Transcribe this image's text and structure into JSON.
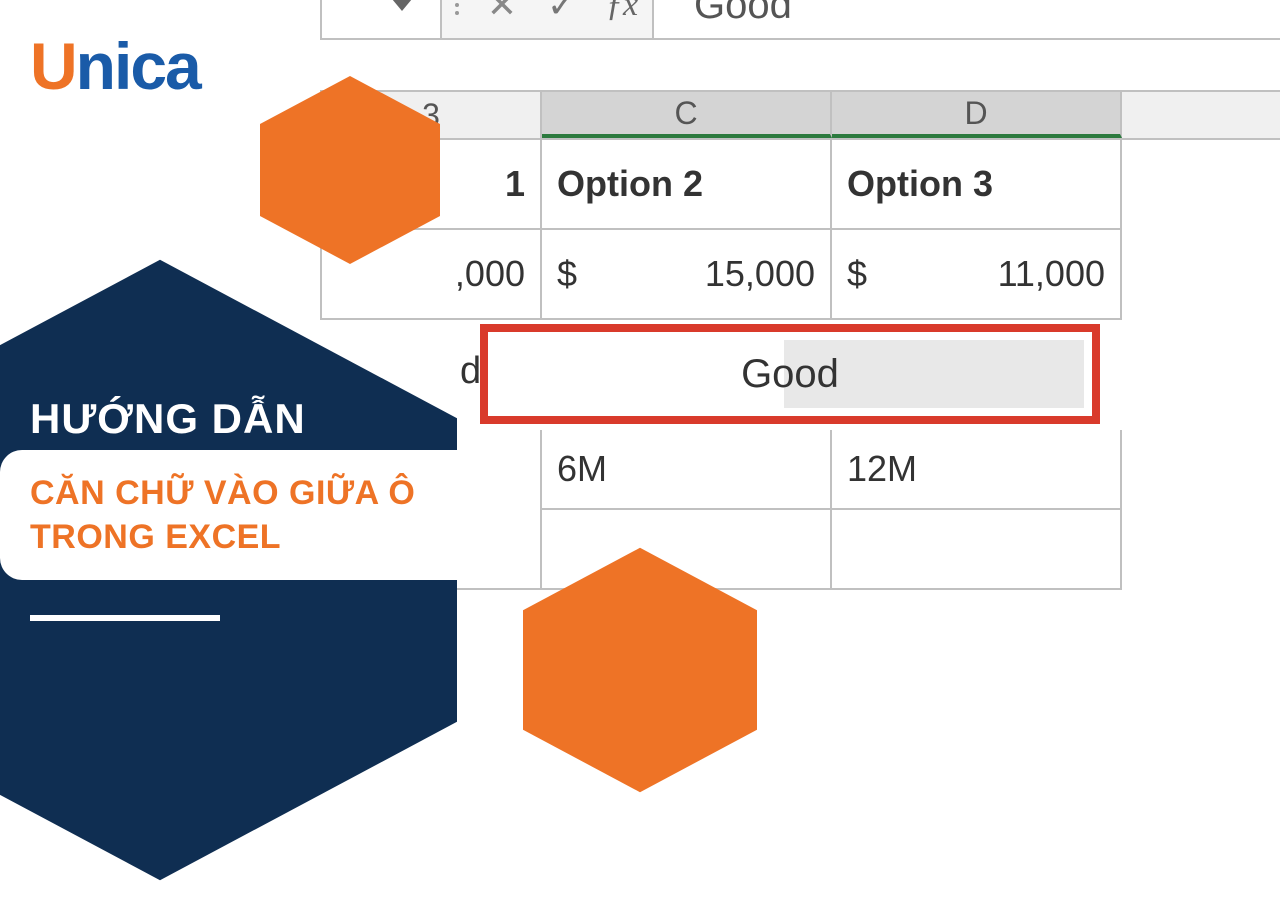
{
  "logo": {
    "part1": "U",
    "part2": "nica"
  },
  "title": {
    "line1": "HƯỚNG DẪN",
    "line2": "CĂN CHỮ VÀO GIỮA Ô TRONG EXCEL"
  },
  "formula_bar": {
    "value": "Good",
    "fx": "ƒx"
  },
  "columns": {
    "b": "3",
    "c": "C",
    "d": "D"
  },
  "rows": {
    "h": {
      "b": "1",
      "c": "Option 2",
      "d": "Option 3"
    },
    "p": {
      "b": ",000",
      "c_sym": "$",
      "c_val": "15,000",
      "d_sym": "$",
      "d_val": "11,000"
    },
    "g": {
      "left": "d",
      "center": "Good"
    },
    "m": {
      "c": "6M",
      "d": "12M"
    }
  }
}
